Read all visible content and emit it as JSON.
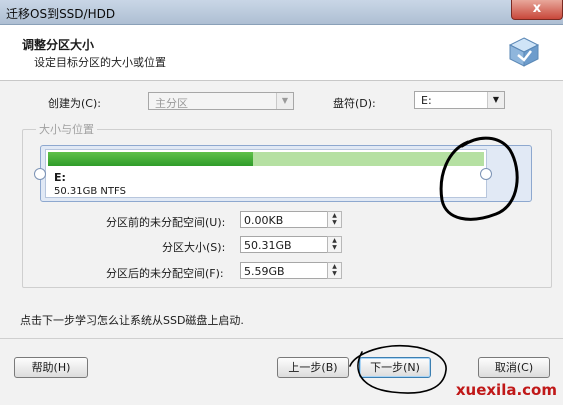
{
  "window": {
    "title": "迁移OS到SSD/HDD",
    "close_glyph": "x"
  },
  "header": {
    "title": "调整分区大小",
    "subtitle": "设定目标分区的大小或位置",
    "icon": "wizard-disk-icon"
  },
  "form": {
    "create_as_label": "创建为(C):",
    "create_as_value": "主分区",
    "drive_letter_label": "盘符(D):",
    "drive_letter_value": "E:"
  },
  "size_group": {
    "legend": "大小与位置",
    "partition": {
      "name": "E:",
      "info": "50.31GB NTFS",
      "used_fraction": 0.47
    }
  },
  "fields": [
    {
      "label": "分区前的未分配空间(U):",
      "value": "0.00KB"
    },
    {
      "label": "分区大小(S):",
      "value": "50.31GB"
    },
    {
      "label": "分区后的未分配空间(F):",
      "value": "5.59GB"
    }
  ],
  "hint": "点击下一步学习怎么让系统从SSD磁盘上启动.",
  "buttons": {
    "help": "帮助(H)",
    "back": "上一步(B)",
    "next": "下一步(N)",
    "cancel": "取消(C)"
  },
  "watermark": "xuexila.com",
  "colors": {
    "bar_used": "#3aa833",
    "bar_free": "#b5e0a2",
    "ink": "#000000",
    "watermark": "#c01818"
  }
}
